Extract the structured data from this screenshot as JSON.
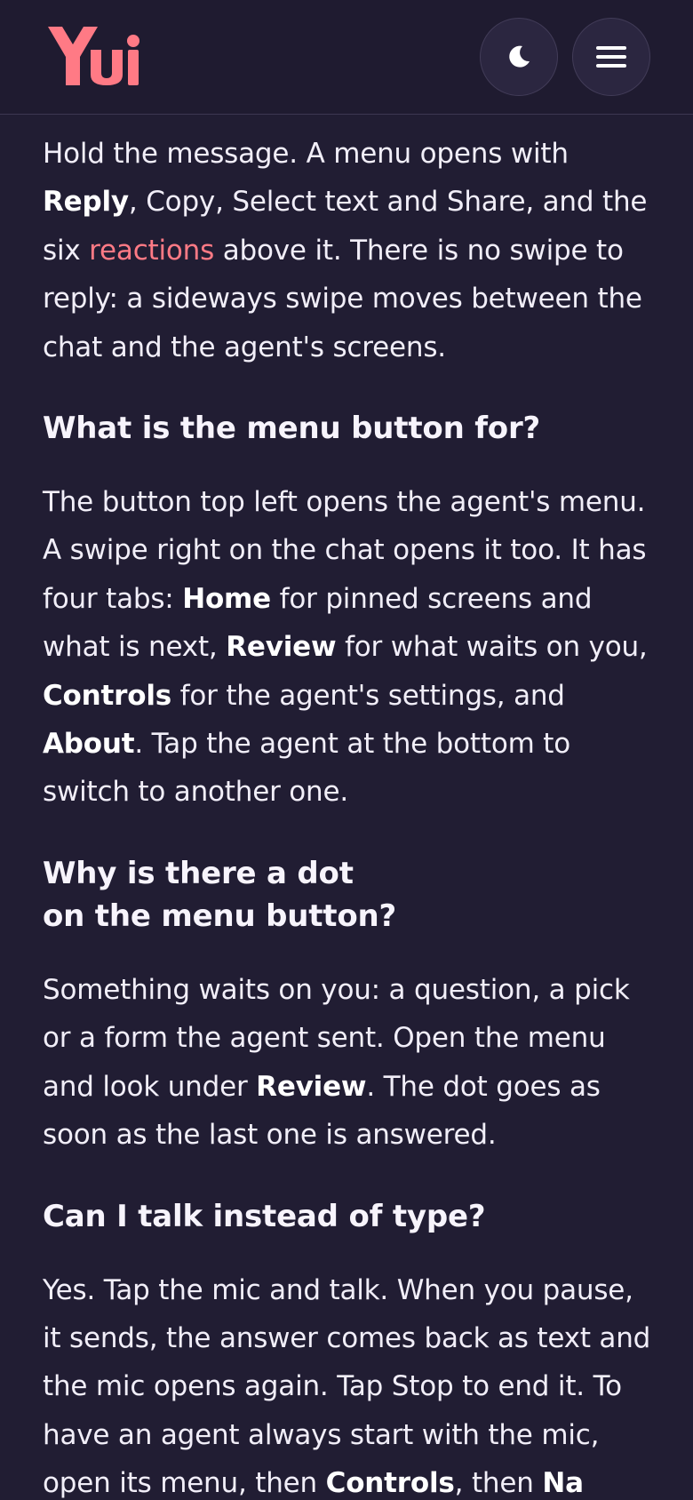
{
  "header": {
    "logo_icon": "yui-logo",
    "accent_color": "#ff7a85",
    "theme_icon": "moon-icon",
    "menu_icon": "hamburger-menu-icon"
  },
  "sections": {
    "s0": {
      "p1": "Hold the message. A menu opens with ",
      "b1": "Reply",
      "p2": ", Copy, Select text and Share, and the six ",
      "link": "reactions",
      "p3": " above it. There is no swipe to reply: a sideways swipe moves between the chat and the agent's screens."
    },
    "s1": {
      "heading": "What is the menu button for?",
      "p1": "The button top left opens the agent's menu. A swipe right on the chat opens it too. It has four tabs: ",
      "b1": "Home",
      "p2": " for pinned screens and what is next, ",
      "b2": "Review",
      "p3": " for what waits on you, ",
      "b3": "Controls",
      "p4": " for the agent's settings, and ",
      "b4": "About",
      "p5": ". Tap the agent at the bottom to switch to another one."
    },
    "s2": {
      "heading_line1": "Why is there a dot",
      "heading_line2": "on the menu button?",
      "p1": "Something waits on you: a question, a pick or a form the agent sent. Open the menu and look under ",
      "b1": "Review",
      "p2": ". The dot goes as soon as the last one is answered."
    },
    "s3": {
      "heading": "Can I talk instead of type?",
      "p1": "Yes. Tap the mic and talk. When you pause, it sends, the answer comes back as text and the mic opens again. Tap Stop to end it. To have an agent always start with the mic, open its menu, then ",
      "b1": "Controls",
      "p2": ", then ",
      "b2": "Na"
    }
  }
}
